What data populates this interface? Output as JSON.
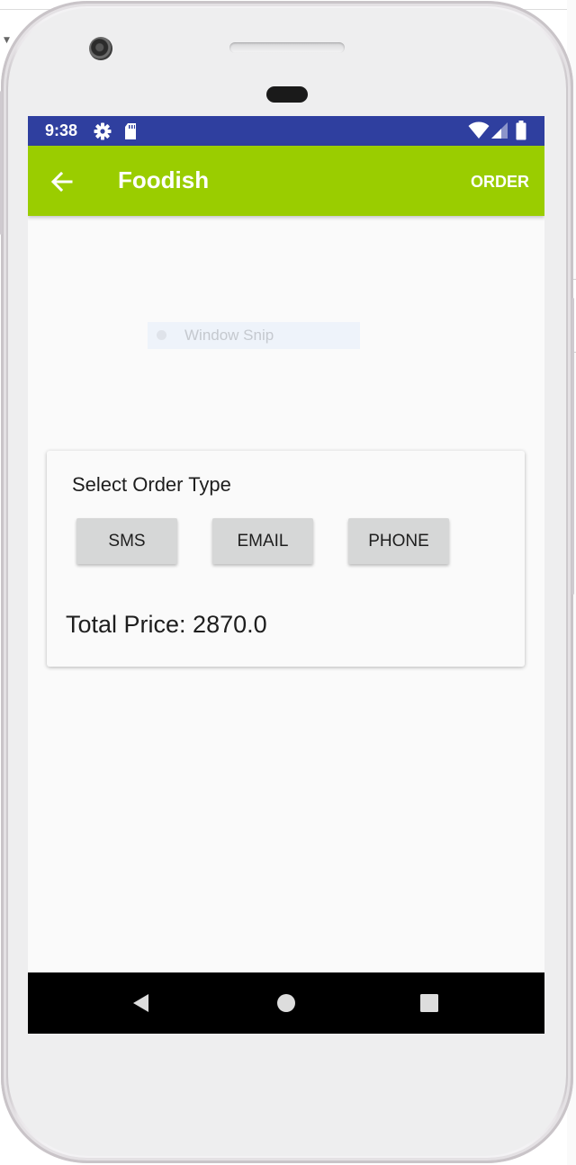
{
  "status_bar": {
    "time": "9:38",
    "icons": [
      "gear-icon",
      "sd-card-icon",
      "wifi-icon",
      "cellular-signal-icon",
      "battery-icon"
    ],
    "color": "#2f3f9f"
  },
  "app_bar": {
    "title": "Foodish",
    "action_label": "ORDER",
    "color": "#9acd00"
  },
  "overlay": {
    "label": "Window Snip"
  },
  "order_card": {
    "title": "Select Order Type",
    "buttons": [
      {
        "label": "SMS"
      },
      {
        "label": "EMAIL"
      },
      {
        "label": "PHONE"
      }
    ],
    "total_price": "Total Price: 2870.0"
  },
  "nav_bar": {
    "icons": [
      "back-triangle-icon",
      "home-circle-icon",
      "recents-square-icon"
    ]
  }
}
